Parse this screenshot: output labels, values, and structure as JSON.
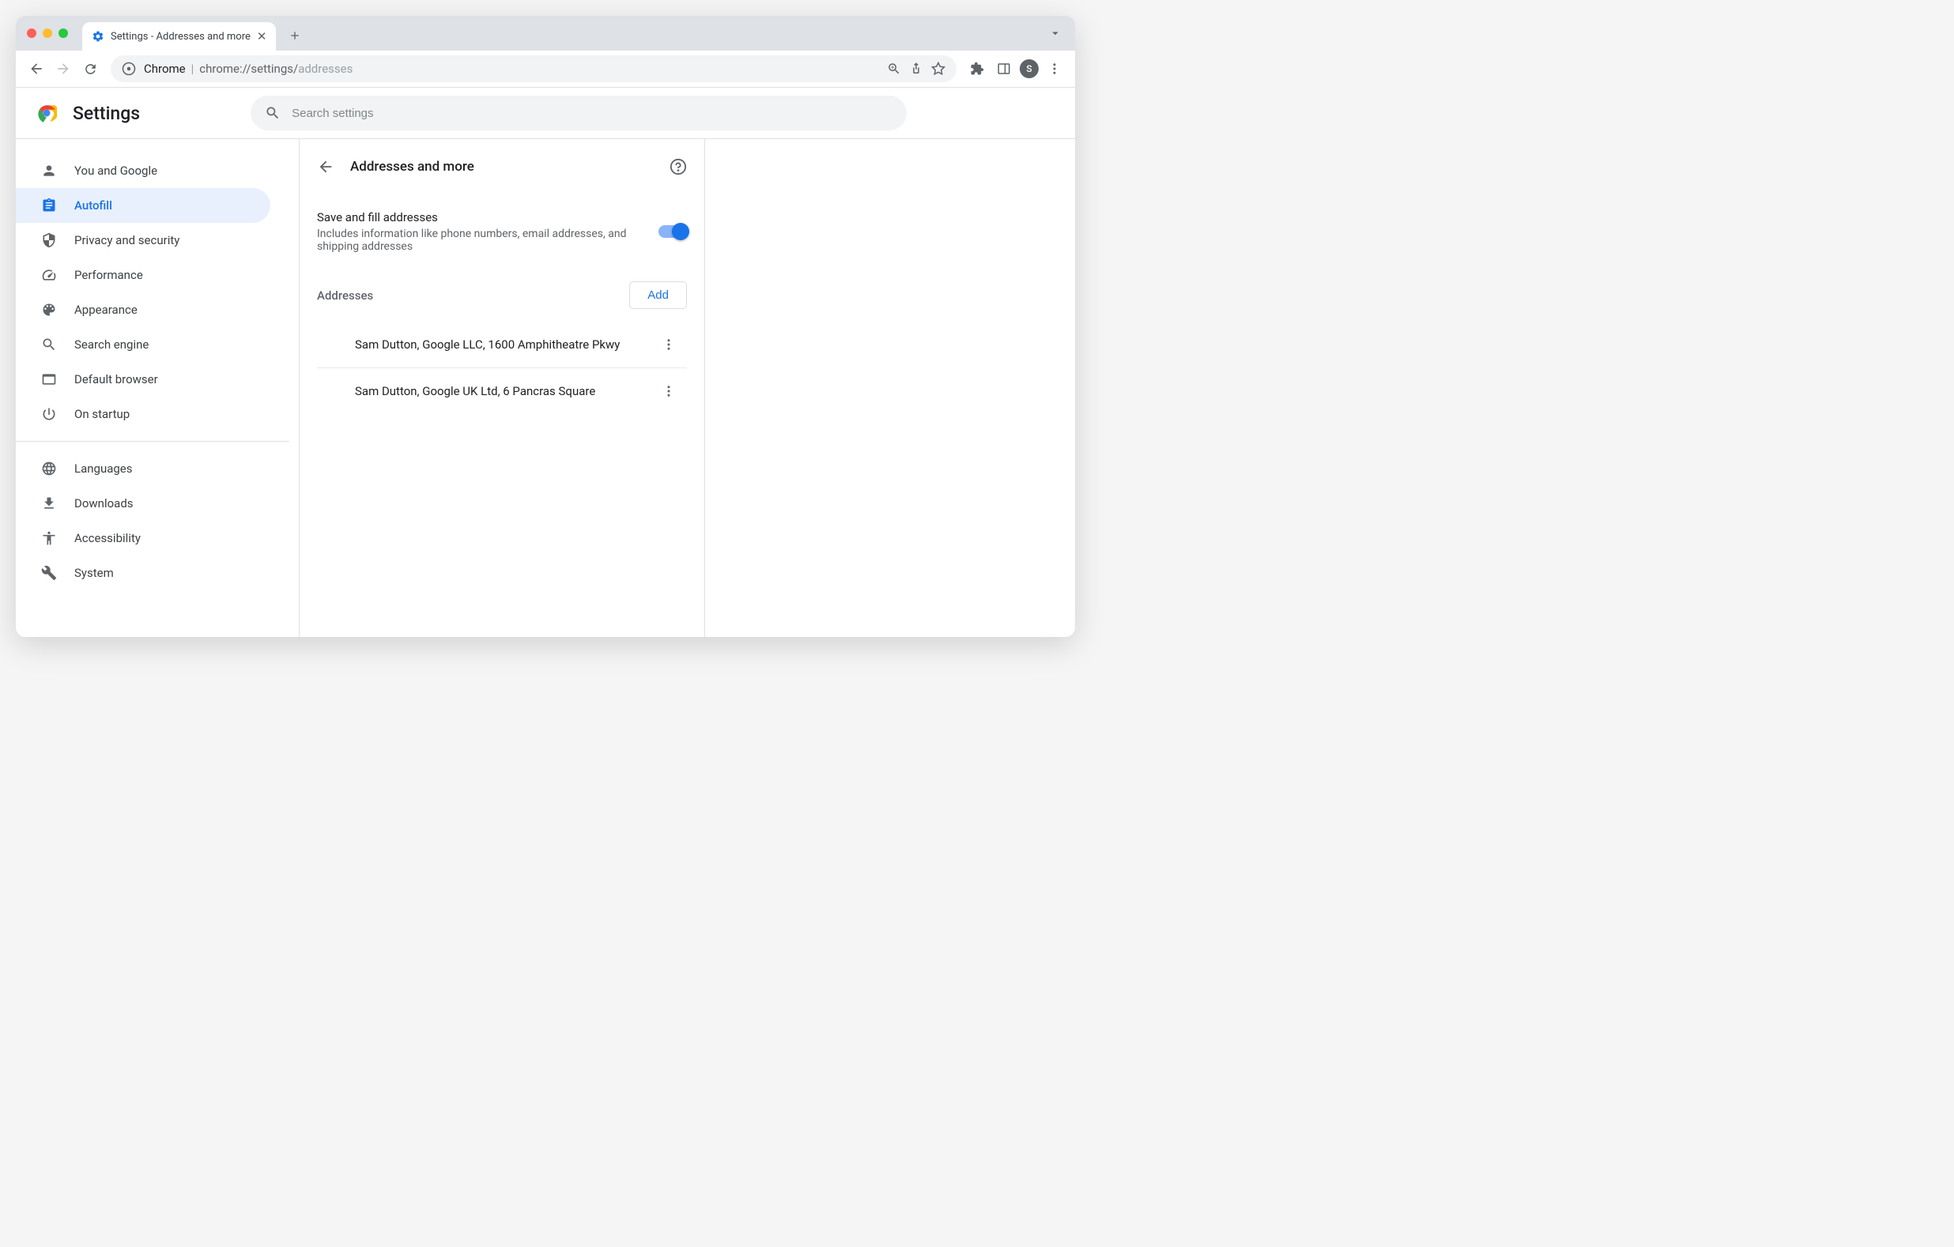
{
  "tab": {
    "title": "Settings - Addresses and more"
  },
  "omnibox": {
    "chrome_label": "Chrome",
    "scheme": "chrome://",
    "path": "settings/",
    "page": "addresses"
  },
  "avatar_letter": "S",
  "app_title": "Settings",
  "search_placeholder": "Search settings",
  "sidebar": {
    "items": [
      {
        "label": "You and Google"
      },
      {
        "label": "Autofill"
      },
      {
        "label": "Privacy and security"
      },
      {
        "label": "Performance"
      },
      {
        "label": "Appearance"
      },
      {
        "label": "Search engine"
      },
      {
        "label": "Default browser"
      },
      {
        "label": "On startup"
      }
    ],
    "items2": [
      {
        "label": "Languages"
      },
      {
        "label": "Downloads"
      },
      {
        "label": "Accessibility"
      },
      {
        "label": "System"
      }
    ]
  },
  "page": {
    "title": "Addresses and more",
    "toggle": {
      "title": "Save and fill addresses",
      "desc": "Includes information like phone numbers, email addresses, and shipping addresses"
    },
    "section_label": "Addresses",
    "add_label": "Add",
    "addresses": [
      {
        "text": "Sam Dutton, Google LLC, 1600 Amphitheatre Pkwy"
      },
      {
        "text": "Sam Dutton, Google UK Ltd, 6 Pancras Square"
      }
    ]
  }
}
